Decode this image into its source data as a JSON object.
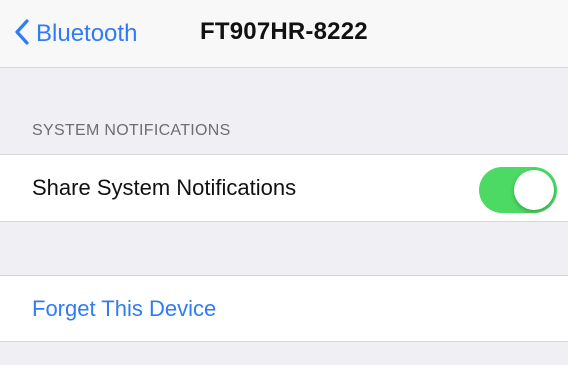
{
  "navbar": {
    "back_label": "Bluetooth",
    "back_icon": "chevron-left-icon",
    "title": "FT907HR-8222"
  },
  "system_notifications": {
    "header": "SYSTEM NOTIFICATIONS",
    "share_label": "Share System Notifications",
    "share_enabled": true
  },
  "device_actions": {
    "forget_label": "Forget This Device"
  },
  "colors": {
    "accent": "#2f7cf6",
    "toggle_on": "#4cd964",
    "background": "#efeff4"
  }
}
